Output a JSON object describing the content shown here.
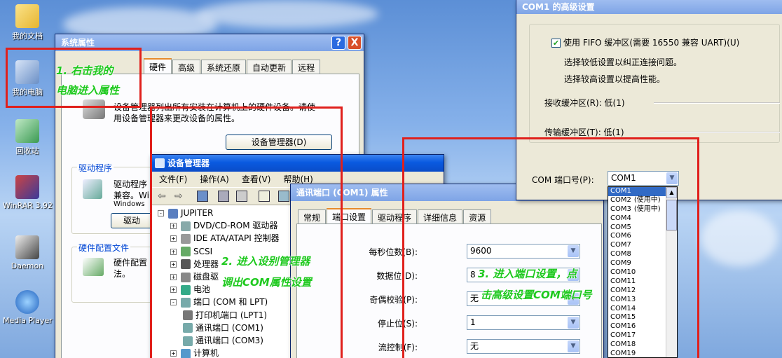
{
  "colors": {
    "annotation_red": "#e0201c",
    "annotation_green": "#1ec91e",
    "xp_title_blue": "#0a5ae0"
  },
  "desktop": {
    "icons": [
      {
        "label": "我的文档",
        "icon": "my-documents-icon"
      },
      {
        "label": "我的电脑",
        "icon": "my-computer-icon"
      },
      {
        "label": "回收站",
        "icon": "recycle-bin-icon"
      },
      {
        "label": "WinRAR 3.92",
        "icon": "winrar-icon"
      },
      {
        "label": "Daemon",
        "icon": "daemon-icon"
      },
      {
        "label": "Media Player",
        "icon": "media-player-icon"
      }
    ]
  },
  "system_props": {
    "title": "系统属性",
    "help": "?",
    "close": "X",
    "tabs": [
      "硬件",
      "高级",
      "系统还原",
      "自动更新",
      "远程"
    ],
    "device_manager_desc_1": "设备管理器列出所有安装在计算机上的硬件设备。请使",
    "device_manager_desc_2": "用设备管理器来更改设备的属性。",
    "device_manager_button": "设备管理器(D)",
    "drivers_group": "驱动程序",
    "drivers_text_1": "驱动程序",
    "drivers_text_2": "兼容。Wi",
    "drivers_text_3": "Windows",
    "drivers_button": "驱动",
    "hw_profiles_group": "硬件配置文件",
    "hw_profiles_text_1": "硬件配置",
    "hw_profiles_text_2": "法。"
  },
  "device_manager": {
    "title": "设备管理器",
    "menu": [
      "文件(F)",
      "操作(A)",
      "查看(V)",
      "帮助(H)"
    ],
    "toolbar": {
      "back": "⇦",
      "forward": "⇨"
    },
    "tree": [
      {
        "label": "JUPITER",
        "pm": "-",
        "indent": 0
      },
      {
        "label": "DVD/CD-ROM 驱动器",
        "pm": "+",
        "indent": 1
      },
      {
        "label": "IDE ATA/ATAPI 控制器",
        "pm": "+",
        "indent": 1
      },
      {
        "label": "SCSI",
        "pm": "+",
        "indent": 1
      },
      {
        "label": "处理器",
        "pm": "+",
        "indent": 1
      },
      {
        "label": "磁盘驱",
        "pm": "+",
        "indent": 1
      },
      {
        "label": "电池",
        "pm": "+",
        "indent": 1
      },
      {
        "label": "端口 (COM 和 LPT)",
        "pm": "-",
        "indent": 1
      },
      {
        "label": "打印机端口 (LPT1)",
        "pm": "",
        "indent": 2
      },
      {
        "label": "通讯端口 (COM1)",
        "pm": "",
        "indent": 2
      },
      {
        "label": "通讯端口 (COM3)",
        "pm": "",
        "indent": 2
      },
      {
        "label": "计算机",
        "pm": "+",
        "indent": 1
      }
    ]
  },
  "com_props": {
    "title": "通讯端口 (COM1) 属性",
    "tabs": [
      "常规",
      "端口设置",
      "驱动程序",
      "详细信息",
      "资源"
    ],
    "fields": [
      {
        "label": "每秒位数(B):",
        "value": "9600"
      },
      {
        "label": "数据位(D):",
        "value": "8"
      },
      {
        "label": "奇偶校验(P):",
        "value": "无"
      },
      {
        "label": "停止位(S):",
        "value": "1"
      },
      {
        "label": "流控制(F):",
        "value": "无"
      }
    ]
  },
  "advanced": {
    "title": "COM1 的高级设置",
    "fifo_label": "使用 FIFO 缓冲区(需要 16550 兼容 UART)(U)",
    "fifo_checked": true,
    "hint_1": "选择较低设置以纠正连接问题。",
    "hint_2": "选择较高设置以提高性能。",
    "rx_label": "接收缓冲区(R): 低(1)",
    "tx_label": "传输缓冲区(T): 低(1)",
    "port_label": "COM 端口号(P):",
    "port_value": "COM1",
    "port_options": [
      {
        "name": "COM1",
        "note": "",
        "selected": true
      },
      {
        "name": "COM2",
        "note": "(使用中)"
      },
      {
        "name": "COM3",
        "note": "(使用中)"
      },
      {
        "name": "COM4"
      },
      {
        "name": "COM5"
      },
      {
        "name": "COM6"
      },
      {
        "name": "COM7"
      },
      {
        "name": "COM8"
      },
      {
        "name": "COM9"
      },
      {
        "name": "COM10"
      },
      {
        "name": "COM11"
      },
      {
        "name": "COM12"
      },
      {
        "name": "COM13"
      },
      {
        "name": "COM14"
      },
      {
        "name": "COM15"
      },
      {
        "name": "COM16"
      },
      {
        "name": "COM17"
      },
      {
        "name": "COM18"
      },
      {
        "name": "COM19"
      }
    ]
  },
  "annotations": {
    "step1_line1": "1. 右击我的",
    "step1_line2": "电脑进入属性",
    "step2_line1": "2. 进入设别管理器",
    "step2_line2": "调出COM属性设置",
    "step3_line1": "3. 进入端口设置，点",
    "step3_line2": "击高级设置COM端口号"
  }
}
